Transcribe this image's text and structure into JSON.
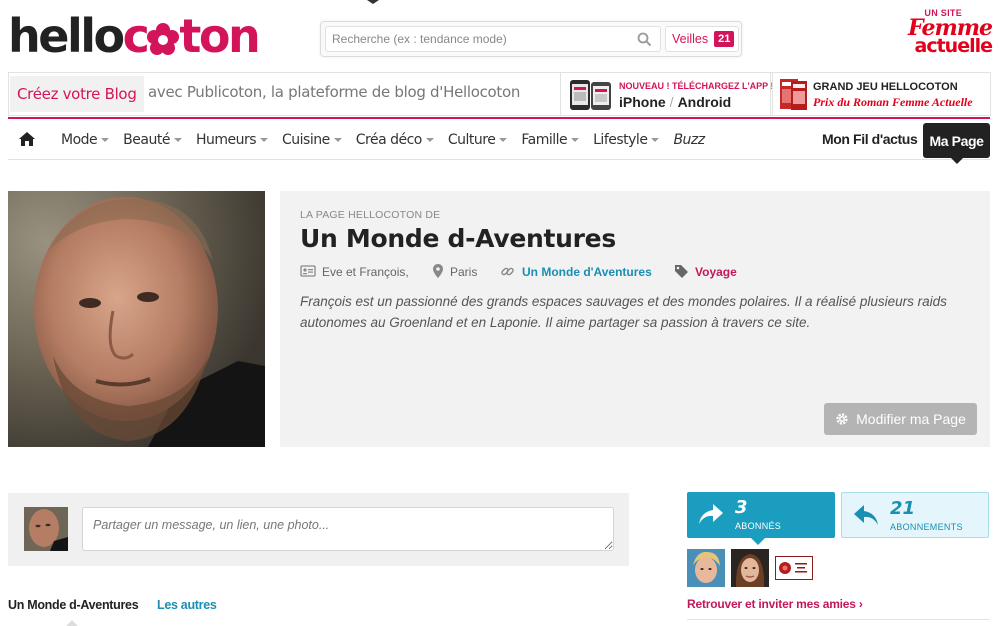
{
  "brand": {
    "logo_part1": "hello",
    "logo_part2": "c",
    "logo_part3": "ton",
    "accent_color": "#d4145a"
  },
  "search": {
    "placeholder": "Recherche (ex : tendance mode)",
    "veilles_label": "Veilles",
    "veilles_count": "21"
  },
  "partner": {
    "tagline": "UN SITE",
    "name_line1": "Femme",
    "name_line2": "actuelle"
  },
  "promo": {
    "blog_cta": "Créez votre Blog",
    "blog_sub": "avec Publicoton, la plateforme de blog d'Hellocoton",
    "app_new": "NOUVEAU ! TÉLÉCHARGEZ L'APP !",
    "app_iphone": "iPhone",
    "app_sep": "/",
    "app_android": "Android",
    "contest_title": "GRAND JEU HELLOCOTON",
    "contest_sub": "Prix du Roman Femme Actuelle"
  },
  "nav": {
    "items": [
      {
        "label": "Mode",
        "dropdown": true
      },
      {
        "label": "Beauté",
        "dropdown": true
      },
      {
        "label": "Humeurs",
        "dropdown": true
      },
      {
        "label": "Cuisine",
        "dropdown": true
      },
      {
        "label": "Créa déco",
        "dropdown": true
      },
      {
        "label": "Culture",
        "dropdown": true
      },
      {
        "label": "Famille",
        "dropdown": true
      },
      {
        "label": "Lifestyle",
        "dropdown": true
      },
      {
        "label": "Buzz",
        "dropdown": false
      }
    ],
    "fil": "Mon Fil d'actus",
    "ma_page": "Ma Page"
  },
  "profile": {
    "kicker": "LA PAGE HELLOCOTON DE",
    "title": "Un Monde d-Aventures",
    "authors": "Eve et François,",
    "city": "Paris",
    "blog": "Un Monde d'Aventures",
    "category": "Voyage",
    "description": "François est un passionné des grands espaces sauvages et des mondes polaires. Il a réalisé plusieurs raids autonomes au Groenland et en Laponie. Il aime partager sa passion à travers ce site.",
    "edit_button": "Modifier ma Page"
  },
  "share": {
    "placeholder": "Partager un message, un lien, une photo..."
  },
  "tabs": {
    "mine": "Un Monde d-Aventures",
    "others": "Les autres"
  },
  "stats": {
    "subscribers_count": "3",
    "subscribers_label": "ABONNÉS",
    "subscriptions_count": "21",
    "subscriptions_label": "ABONNEMENTS"
  },
  "invite": {
    "label": "Retrouver et inviter mes amies ›"
  }
}
